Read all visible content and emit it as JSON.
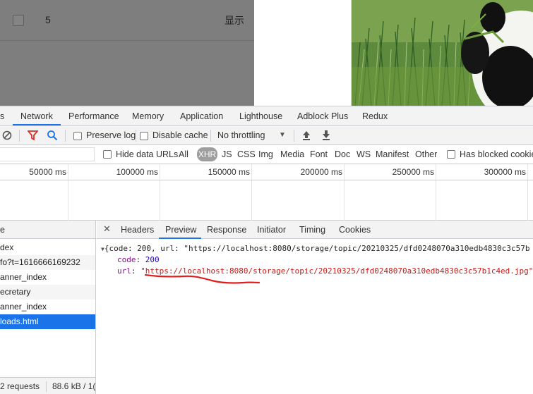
{
  "page": {
    "row_number": "5",
    "row_action": "显示"
  },
  "devtools": {
    "tabs": [
      "s",
      "Network",
      "Performance",
      "Memory",
      "Application",
      "Lighthouse",
      "Adblock Plus",
      "Redux"
    ],
    "toolbar": {
      "preserve_log": "Preserve log",
      "disable_cache": "Disable cache",
      "throttling": "No throttling"
    },
    "filter": {
      "hide_data_urls": "Hide data URLs",
      "types": [
        "All",
        "XHR",
        "JS",
        "CSS",
        "Img",
        "Media",
        "Font",
        "Doc",
        "WS",
        "Manifest",
        "Other"
      ],
      "has_blocked_cookies": "Has blocked cookie"
    },
    "timeline_ticks": [
      "50000 ms",
      "100000 ms",
      "150000 ms",
      "200000 ms",
      "250000 ms",
      "300000 ms"
    ],
    "request_list": {
      "header": "e",
      "rows": [
        "dex",
        "fo?t=1616666169232",
        "anner_index",
        "ecretary",
        "anner_index",
        "loads.html"
      ],
      "selected_index": 5,
      "status_requests": "2 requests",
      "status_size": "88.6 kB / 1("
    },
    "details": {
      "tabs": [
        "Headers",
        "Preview",
        "Response",
        "Initiator",
        "Timing",
        "Cookies"
      ],
      "active_tab": "Preview",
      "json_root": "{code: 200, url: \"https://localhost:8080/storage/topic/20210325/dfd0248070a310edb4830c3c57b",
      "code_key": "code",
      "code_value": "200",
      "url_key": "url",
      "url_value": "\"https://localhost:8080/storage/topic/20210325/dfd0248070a310edb4830c3c57b1c4ed.jpg\""
    }
  }
}
